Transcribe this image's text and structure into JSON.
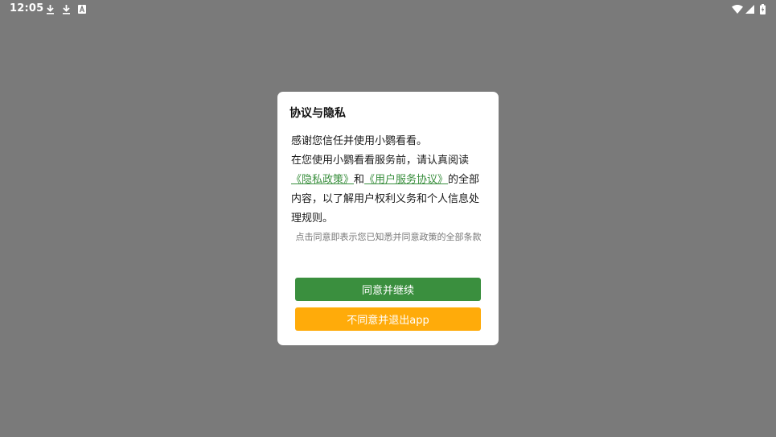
{
  "status_bar": {
    "time": "12:05",
    "icons": [
      "download-icon",
      "download-icon",
      "font-a-icon",
      "wifi-icon",
      "cell-signal-icon",
      "battery-charging-icon"
    ]
  },
  "dialog": {
    "title": "协议与隐私",
    "line1": "感谢您信任并使用小鹦看看。",
    "line2_prefix": "在您使用小鹦看看服务前，请认真阅读",
    "privacy_link": "《隐私政策》",
    "and_text": "和",
    "user_agreement_link": "《用户服务协议》",
    "line2_suffix": "的全部内容，以了解用户权利义务和个人信息处理规则。",
    "note": "点击同意即表示您已知悉并同意政策的全部条款",
    "agree_button": "同意并继续",
    "disagree_button": "不同意并退出app"
  },
  "colors": {
    "overlay": "#7a7a7a",
    "accent_green": "#3a8f3e",
    "accent_orange": "#ffab0a"
  }
}
